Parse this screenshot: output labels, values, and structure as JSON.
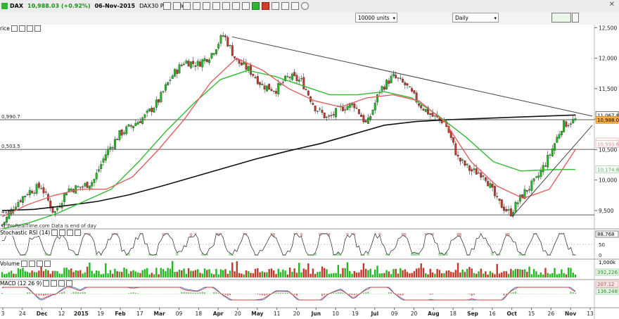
{
  "header": {
    "instrument": "DAX",
    "price_change": "10,988.03 (+0.92%)",
    "date": "06-Nov-2015",
    "description": "DAX30 Perf Index",
    "units": "10000 units",
    "timeframe": "Daily"
  },
  "colors": {
    "up": "#22b822",
    "down": "#c0392b",
    "ma_fast": "#e06060",
    "ma_mid": "#33bb33",
    "ma_slow": "#111111",
    "accent_green": "#2fb52f",
    "axis_tag_dark": "#333333"
  },
  "price_panel": {
    "title": "rice",
    "levels": [
      {
        "label": "0,990.7",
        "value": 10990.7
      },
      {
        "label": "0,503.5",
        "value": 10503.5
      },
      {
        "label": "4165",
        "value": 9430
      }
    ],
    "price_tags": [
      {
        "label": "11,067.8",
        "value": 11067.8,
        "style": "outline"
      },
      {
        "label": "10,988.0",
        "value": 10988.0,
        "style": "orange"
      },
      {
        "label": "10,633.2",
        "value": 10633.2,
        "style": "pink-faint"
      },
      {
        "label": "10,593.6",
        "value": 10593.6,
        "style": "pink-faint"
      },
      {
        "label": "10,174.8",
        "value": 10174.8,
        "style": "green-faint"
      }
    ],
    "y_ticks": [
      "12,500",
      "12,000",
      "11,500",
      "11,000",
      "10,500",
      "10,000",
      "9,500"
    ],
    "y_tick_values": [
      12500,
      12000,
      11500,
      11000,
      10500,
      10000,
      9500
    ],
    "watermark": "© ProRealTime.com  Data is end of day"
  },
  "stoch_panel": {
    "title": "Stochastic RSI (14)",
    "value_tag": "88.768",
    "ticks": [
      "100",
      "50",
      "0"
    ]
  },
  "volume_panel": {
    "title": "Volume",
    "ticks": [
      "1,000k",
      "392,226"
    ]
  },
  "macd_panel": {
    "title": "MACD (12 26 9)",
    "tags": [
      "207.12",
      "136.248"
    ]
  },
  "x_axis": {
    "labels": [
      "3",
      "24",
      "Dec",
      "12",
      "2015",
      "19",
      "Feb",
      "17",
      "Mar",
      "09",
      "18",
      "Apr",
      "20",
      "May",
      "11",
      "20",
      "Jun",
      "10",
      "19",
      "Jul",
      "09",
      "20",
      "Aug",
      "18",
      "Sep",
      "16",
      "Oct",
      "15",
      "26",
      "Nov",
      "13"
    ]
  },
  "chart_data": {
    "type": "candlestick",
    "instrument": "DAX",
    "timeframe": "Daily",
    "ylim": [
      9200,
      12550
    ],
    "x": [
      "Nov",
      "Dec",
      "2015",
      "Jan",
      "Feb",
      "Mar",
      "Apr",
      "May",
      "Jun",
      "Jul",
      "Aug",
      "Sep",
      "Oct",
      "Nov"
    ],
    "close_path": [
      9260,
      9600,
      9810,
      9900,
      9450,
      9850,
      9880,
      9980,
      10450,
      10750,
      10900,
      11050,
      11300,
      11700,
      11950,
      11900,
      12050,
      12390,
      11950,
      11800,
      11550,
      11480,
      11700,
      11620,
      11200,
      11000,
      11180,
      11250,
      10900,
      11480,
      11700,
      11550,
      11250,
      11050,
      10950,
      10350,
      10150,
      10100,
      9650,
      9450,
      9780,
      10000,
      10400,
      10900,
      10988
    ],
    "series": [
      {
        "name": "Price",
        "close_path_ref": "close_path"
      },
      {
        "name": "MA fast",
        "approx": [
          9400,
          9600,
          9750,
          9850,
          9850,
          10050,
          10500,
          11000,
          11600,
          12000,
          11800,
          11500,
          11300,
          11200,
          11350,
          11400,
          11300,
          10950,
          10300,
          9900,
          9700,
          9850,
          10500
        ]
      },
      {
        "name": "MA mid",
        "approx": [
          9200,
          9300,
          9450,
          9650,
          9850,
          10300,
          10800,
          11250,
          11650,
          11800,
          11700,
          11550,
          11400,
          11400,
          11450,
          11350,
          11050,
          10700,
          10300,
          10150,
          10170,
          10175
        ]
      },
      {
        "name": "MA slow",
        "approx": [
          9500,
          9520,
          9580,
          9650,
          9760,
          9900,
          10050,
          10200,
          10350,
          10480,
          10600,
          10750,
          10900,
          10960,
          10990,
          11010,
          11030,
          11050,
          11068
        ]
      }
    ],
    "trendlines": [
      {
        "from": {
          "x": "Apr",
          "y": 12350
        },
        "to": {
          "x": "Nov",
          "y": 11050
        }
      },
      {
        "from": {
          "x": "Oct",
          "y": 9400
        },
        "to": {
          "x": "Nov",
          "y": 10900
        }
      }
    ],
    "horizontal_levels": [
      10990.7,
      10503.5,
      9430
    ]
  }
}
